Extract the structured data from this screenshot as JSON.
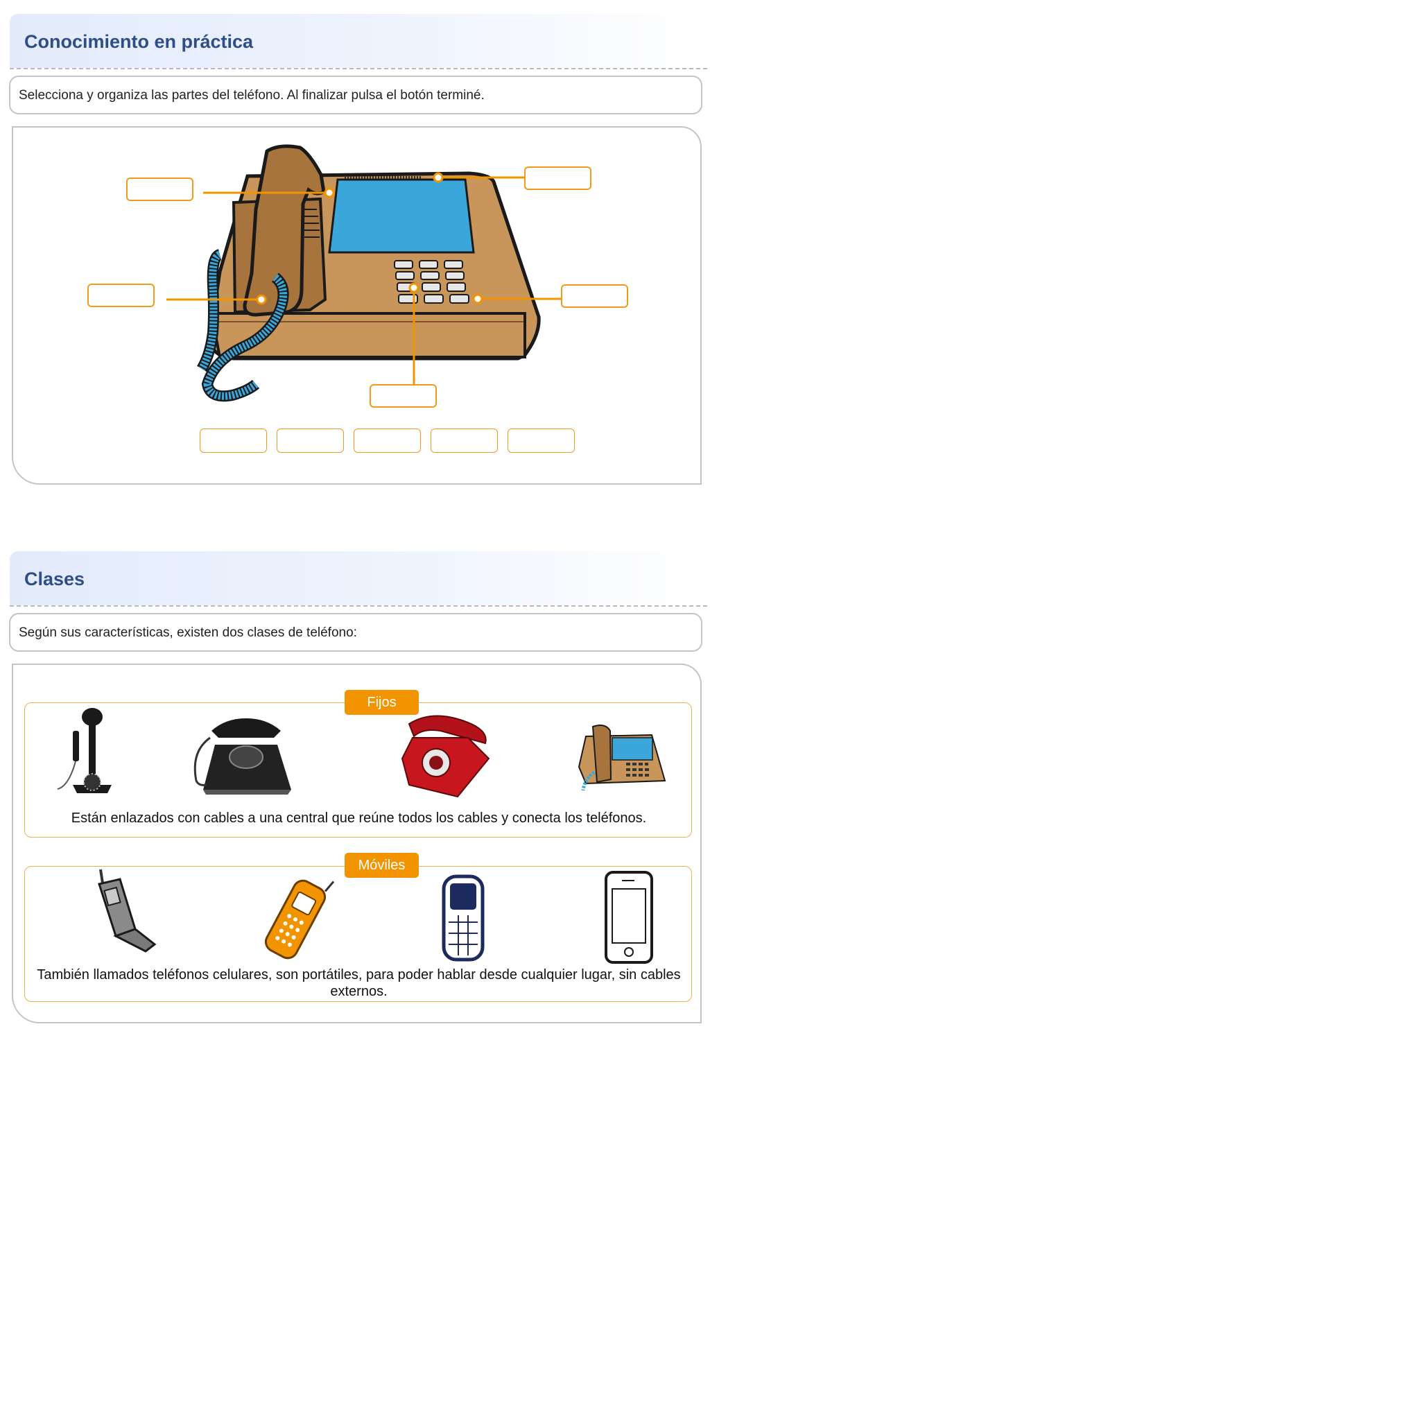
{
  "section1": {
    "title": "Conocimiento en práctica",
    "instruction": "Selecciona  y organiza las partes del teléfono. Al finalizar pulsa el botón terminé."
  },
  "section2": {
    "title": "Clases",
    "instruction": "Según sus características, existen dos clases de teléfono:",
    "fijos": {
      "tag": "Fijos",
      "description": "Están enlazados con cables  a una central que reúne todos los cables y conecta los teléfonos."
    },
    "moviles": {
      "tag": "Móviles",
      "description": "También llamados teléfonos celulares, son portátiles, para poder hablar desde cualquier lugar, sin cables externos."
    }
  },
  "colors": {
    "accent": "#f29400",
    "title": "#2f4e86",
    "phone_body": "#c8955a",
    "screen": "#3aa6d9"
  }
}
